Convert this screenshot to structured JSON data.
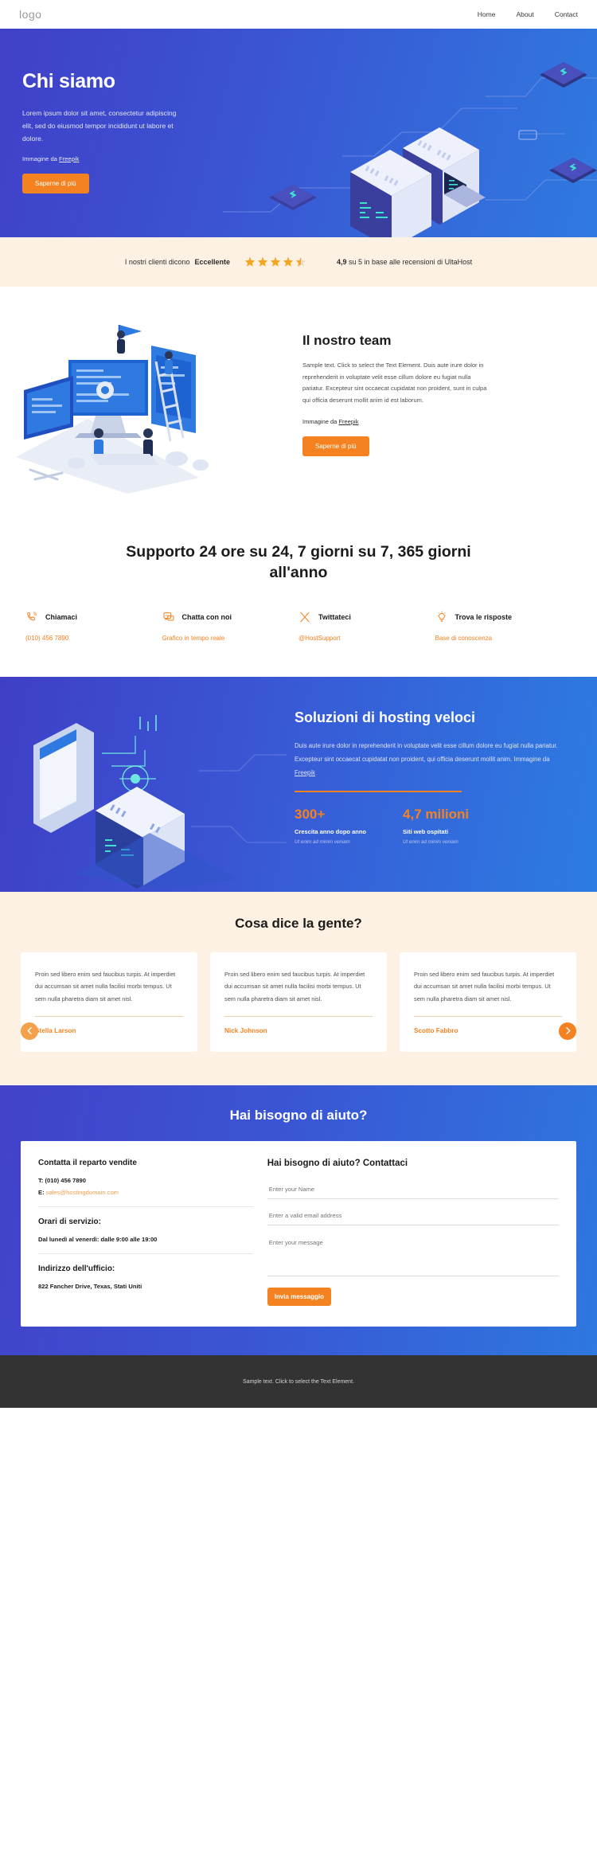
{
  "header": {
    "logo": "logo",
    "nav": [
      {
        "label": "Home"
      },
      {
        "label": "About"
      },
      {
        "label": "Contact"
      }
    ]
  },
  "hero": {
    "title": "Chi siamo",
    "paragraph": "Lorem ipsum dolor sit amet, consectetur adipiscing elit, sed do eiusmod tempor incididunt ut labore et dolore.",
    "attribution_prefix": "Immagine da ",
    "attribution_link": "Freepik",
    "cta": "Saperne di più"
  },
  "rating": {
    "lead": "I nostri clienti dicono",
    "verdict": "Eccellente",
    "stars_filled": 4,
    "stars_half": 1,
    "stars_total": 5,
    "score": "4,9",
    "score_rest": " su 5 in base alle recensioni di UltaHost",
    "star_color": "#f5a623",
    "background": "#fdf1e4"
  },
  "team": {
    "title": "Il nostro team",
    "paragraph": "Sample text. Click to select the Text Element. Duis aute irure dolor in reprehenderit in voluptate velit esse cillum dolore eu fugiat nulla pariatur. Excepteur sint occaecat cupidatat non proident, sunt in culpa qui officia deserunt mollit anim id est laborum.",
    "attribution_prefix": "Immagine da ",
    "attribution_link": "Freepik",
    "cta": "Saperne di più"
  },
  "support": {
    "title": "Supporto 24 ore su 24, 7 giorni su 7, 365 giorni all'anno",
    "columns": [
      {
        "icon": "phone-icon",
        "label": "Chiamaci",
        "value": "(010) 456 7890"
      },
      {
        "icon": "chat-icon",
        "label": "Chatta con noi",
        "value": "Grafico in tempo reale"
      },
      {
        "icon": "x-twitter-icon",
        "label": "Twittateci",
        "value": "@HostSupport"
      },
      {
        "icon": "lightbulb-icon",
        "label": "Trova le risposte",
        "value": "Base di conoscenza"
      }
    ],
    "accent": "#f58220"
  },
  "hosting": {
    "title": "Soluzioni di hosting veloci",
    "paragraph": "Duis aute irure dolor in reprehenderit in voluptate velit esse cillum dolore eu fugiat nulla pariatur. Excepteur sint occaecat cupidatat non proident, qui officia deserunt mollit anim.",
    "attribution_prefix": " Immagine da ",
    "attribution_link": "Freepik",
    "stats": [
      {
        "number": "300+",
        "label": "Crescita anno dopo anno",
        "sub": "Ut enim ad minim veniam"
      },
      {
        "number": "4,7 milioni",
        "label": "Siti web ospitati",
        "sub": "Ut enim ad minim veniam"
      }
    ]
  },
  "testimonials": {
    "title": "Cosa dice la gente?",
    "prev_icon": "chevron-left-icon",
    "next_icon": "chevron-right-icon",
    "items": [
      {
        "quote": "Proin sed libero enim sed faucibus turpis. At imperdiet dui accumsan sit amet nulla facilisi morbi tempus. Ut sem nulla pharetra diam sit amet nisl.",
        "author": "Stella Larson"
      },
      {
        "quote": "Proin sed libero enim sed faucibus turpis. At imperdiet dui accumsan sit amet nulla facilisi morbi tempus. Ut sem nulla pharetra diam sit amet nisl.",
        "author": "Nick Johnson"
      },
      {
        "quote": "Proin sed libero enim sed faucibus turpis. At imperdiet dui accumsan sit amet nulla facilisi morbi tempus. Ut sem nulla pharetra diam sit amet nisl.",
        "author": "Scotto Fabbro"
      }
    ]
  },
  "contact": {
    "title": "Hai bisogno di aiuto?",
    "sales_heading": "Contatta il reparto vendite",
    "phone_prefix": "T: ",
    "phone": "(010) 456 7890",
    "email_prefix": "E: ",
    "email": "sales@hostingdomain.com",
    "hours_heading": "Orari di servizio:",
    "hours_value": "Dal lunedì al venerdì: dalle 9:00 alle 19:00",
    "address_heading": "Indirizzo dell'ufficio:",
    "address_value": "822 Fancher Drive, Texas, Stati Uniti",
    "form_title": "Hai bisogno di aiuto? Contattaci",
    "name_placeholder": "Enter your Name",
    "email_placeholder": "Enter a valid email address",
    "message_placeholder": "Enter your message",
    "name_value": "",
    "email_value": "",
    "message_value": "",
    "submit": "Invia messaggio"
  },
  "footer": {
    "text": "Sample text. Click to select the Text Element."
  }
}
